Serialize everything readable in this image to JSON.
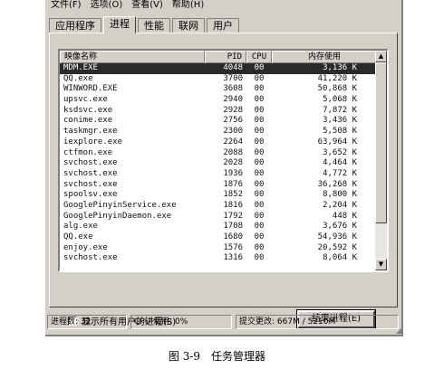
{
  "menu": {
    "file": "文件(F)",
    "options": "选项(O)",
    "view": "查看(V)",
    "help": "帮助(H)"
  },
  "tabs": [
    "应用程序",
    "进程",
    "性能",
    "联网",
    "用户"
  ],
  "active_tab": 1,
  "columns": {
    "name": "映像名称",
    "pid": "PID",
    "cpu": "CPU",
    "mem": "内存使用"
  },
  "rows": [
    {
      "name": "MDM.EXE",
      "pid": "4048",
      "cpu": "00",
      "mem": "3,136 K",
      "selected": true
    },
    {
      "name": "QQ.exe",
      "pid": "3700",
      "cpu": "00",
      "mem": "41,220 K"
    },
    {
      "name": "WINWORD.EXE",
      "pid": "3608",
      "cpu": "00",
      "mem": "50,868 K"
    },
    {
      "name": "upsvc.exe",
      "pid": "2940",
      "cpu": "00",
      "mem": "5,068 K"
    },
    {
      "name": "ksdsvc.exe",
      "pid": "2928",
      "cpu": "00",
      "mem": "7,872 K"
    },
    {
      "name": "conime.exe",
      "pid": "2756",
      "cpu": "00",
      "mem": "3,436 K"
    },
    {
      "name": "taskmgr.exe",
      "pid": "2300",
      "cpu": "00",
      "mem": "5,508 K"
    },
    {
      "name": "iexplore.exe",
      "pid": "2264",
      "cpu": "00",
      "mem": "63,964 K"
    },
    {
      "name": "ctfmon.exe",
      "pid": "2088",
      "cpu": "00",
      "mem": "3,652 K"
    },
    {
      "name": "svchost.exe",
      "pid": "2028",
      "cpu": "00",
      "mem": "4,464 K"
    },
    {
      "name": "svchost.exe",
      "pid": "1936",
      "cpu": "00",
      "mem": "4,772 K"
    },
    {
      "name": "svchost.exe",
      "pid": "1876",
      "cpu": "00",
      "mem": "36,268 K"
    },
    {
      "name": "spoolsv.exe",
      "pid": "1852",
      "cpu": "00",
      "mem": "8,800 K"
    },
    {
      "name": "GooglePinyinService.exe",
      "pid": "1816",
      "cpu": "00",
      "mem": "2,204 K"
    },
    {
      "name": "GooglePinyinDaemon.exe",
      "pid": "1792",
      "cpu": "00",
      "mem": "448 K"
    },
    {
      "name": "alg.exe",
      "pid": "1708",
      "cpu": "00",
      "mem": "3,676 K"
    },
    {
      "name": "QQ.exe",
      "pid": "1680",
      "cpu": "00",
      "mem": "54,936 K"
    },
    {
      "name": "enjoy.exe",
      "pid": "1576",
      "cpu": "00",
      "mem": "20,592 K"
    },
    {
      "name": "svchost.exe",
      "pid": "1316",
      "cpu": "00",
      "mem": "8,064 K"
    }
  ],
  "show_all_users": "显示所有用户的进程(S)",
  "end_process": "结束进程(E)",
  "status": {
    "processes": "进程数: 32",
    "cpu": "CPU 使用: 0%",
    "commit": "提交更改: 667M / 5210M"
  },
  "caption": "图 3-9　任务管理器"
}
